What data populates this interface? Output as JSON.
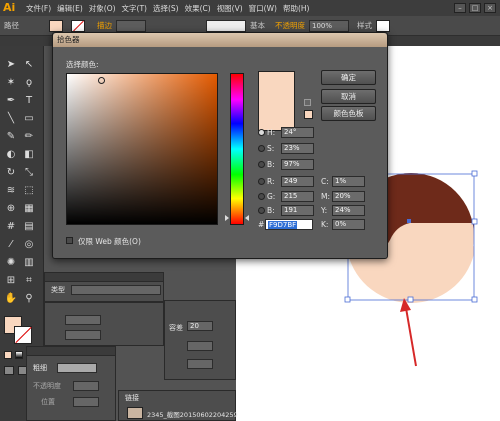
{
  "menubar": {
    "logo": "Ai",
    "items": [
      "文件(F)",
      "编辑(E)",
      "对象(O)",
      "文字(T)",
      "选择(S)",
      "效果(C)",
      "视图(V)",
      "窗口(W)",
      "帮助(H)"
    ]
  },
  "control_bar": {
    "path_label": "路径",
    "stroke_label": "描边",
    "basic_label": "基本",
    "opacity_label": "不透明度",
    "opacity_value": "100%",
    "style_label": "样式"
  },
  "dialog": {
    "title": "拾色器",
    "select_color_label": "选择颜色:",
    "ok_label": "确定",
    "cancel_label": "取消",
    "swatches_label": "颜色色板",
    "web_only_label": "仅限 Web 颜色(O)",
    "current_color": "#F9D7BF",
    "fields": {
      "H": {
        "label": "H:",
        "value": "24°",
        "unit": ""
      },
      "S": {
        "label": "S:",
        "value": "23%",
        "unit": ""
      },
      "B": {
        "label": "B:",
        "value": "97%",
        "unit": ""
      },
      "R": {
        "label": "R:",
        "value": "249",
        "unit": ""
      },
      "G": {
        "label": "G:",
        "value": "215",
        "unit": ""
      },
      "Bl": {
        "label": "B:",
        "value": "191",
        "unit": ""
      },
      "C": {
        "label": "C:",
        "value": "1%",
        "unit": ""
      },
      "M": {
        "label": "M:",
        "value": "20%",
        "unit": ""
      },
      "Y": {
        "label": "Y:",
        "value": "24%",
        "unit": ""
      },
      "K": {
        "label": "K:",
        "value": "0%",
        "unit": ""
      }
    },
    "hex_label": "#",
    "hex_value": "F9D7BF"
  },
  "panels": {
    "type_label": "类型",
    "stroke_label": "描边",
    "opacity_label": "不透明度",
    "position_label": "位置",
    "thickness_label": "粗细",
    "capacity_label": "容差",
    "capacity_value": "20",
    "link_label": "链接",
    "filename": "2345_截图20150602204259"
  },
  "colors": {
    "shape_dark": "#6e2a1a",
    "shape_light": "#f9d7bf",
    "selection": "#4a6cd4",
    "arrow": "#d62828"
  }
}
